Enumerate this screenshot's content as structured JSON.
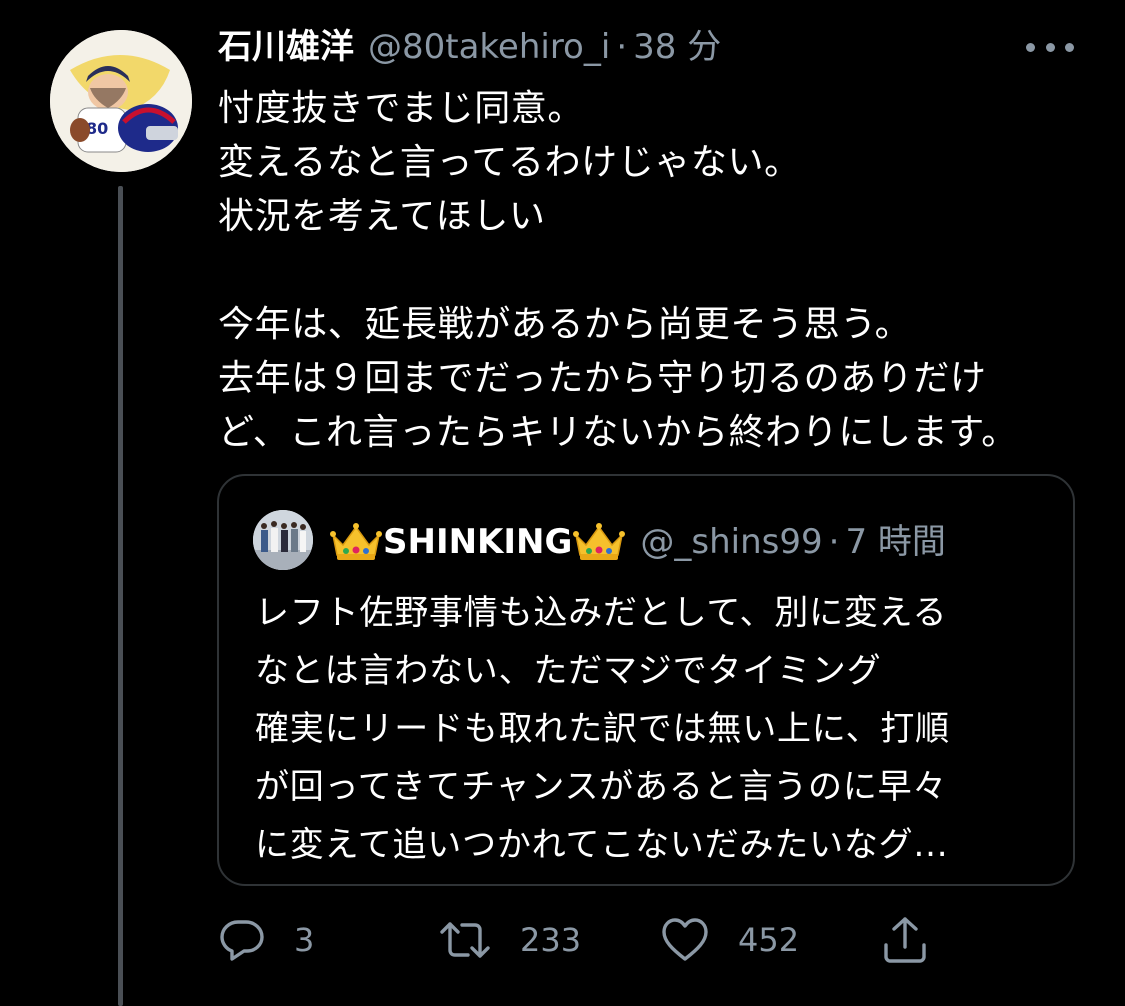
{
  "tweet": {
    "display_name": "石川雄洋",
    "handle": "@80takehiro_i",
    "separator": "·",
    "time": "38 分",
    "lines": [
      "忖度抜きでまじ同意。",
      "変えるなと言ってるわけじゃない。",
      "状況を考えてほしい",
      "",
      "今年は、延長戦があるから尚更そう思う。",
      "去年は９回までだったから守り切るのありだけ",
      "ど、これ言ったらキリないから終わりにします。"
    ]
  },
  "quote": {
    "display_name": "SHINKING",
    "handle": "@_shins99",
    "separator": "·",
    "time": "7 時間",
    "lines": [
      "レフト佐野事情も込みだとして、別に変える",
      "なとは言わない、ただマジでタイミング",
      "確実にリードも取れた訳では無い上に、打順",
      "が回ってきてチャンスがあると言うのに早々",
      "に変えて追いつかれてこないだみたいなグ..."
    ]
  },
  "actions": {
    "reply_count": "3",
    "retweet_count": "233",
    "like_count": "452"
  },
  "icons": {
    "more": "more-horizontal-icon",
    "reply": "reply-icon",
    "retweet": "retweet-icon",
    "like": "heart-icon",
    "share": "share-icon"
  },
  "colors": {
    "background": "#000000",
    "text": "#ffffff",
    "secondary": "#8b98a5",
    "border": "#2f3336",
    "thread_line": "#4a4f55"
  }
}
